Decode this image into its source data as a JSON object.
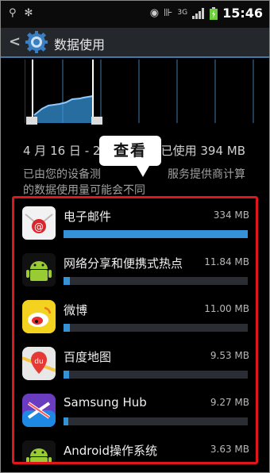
{
  "status_bar": {
    "time": "15:46",
    "network": "3G"
  },
  "header": {
    "title": "数据使用"
  },
  "summary": {
    "date_left": "4 月 16 日 - 2",
    "usage_text": "已使用 394 MB",
    "note_line1_left": "已由您的设备测",
    "note_line1_right": "服务提供商计算",
    "note_line2": "的数据使用量可能会不同"
  },
  "callout": {
    "label": "查看"
  },
  "apps": [
    {
      "name": "电子邮件",
      "size": "334 MB",
      "usage_fraction": 1.0,
      "icon": "email-icon"
    },
    {
      "name": "网络分享和便携式热点",
      "size": "11.84 MB",
      "usage_fraction": 0.035,
      "icon": "android-icon"
    },
    {
      "name": "微博",
      "size": "11.00 MB",
      "usage_fraction": 0.033,
      "icon": "weibo-icon"
    },
    {
      "name": "百度地图",
      "size": "9.53 MB",
      "usage_fraction": 0.029,
      "icon": "baidu-map-icon"
    },
    {
      "name": "Samsung Hub",
      "size": "9.27 MB",
      "usage_fraction": 0.028,
      "icon": "samsung-hub-icon"
    },
    {
      "name": "Android操作系统",
      "size": "3.63 MB",
      "usage_fraction": 0.011,
      "icon": "android-icon"
    }
  ],
  "colors": {
    "accent": "#3592d6",
    "highlight_border": "#e0161b",
    "header": "#24272c"
  }
}
